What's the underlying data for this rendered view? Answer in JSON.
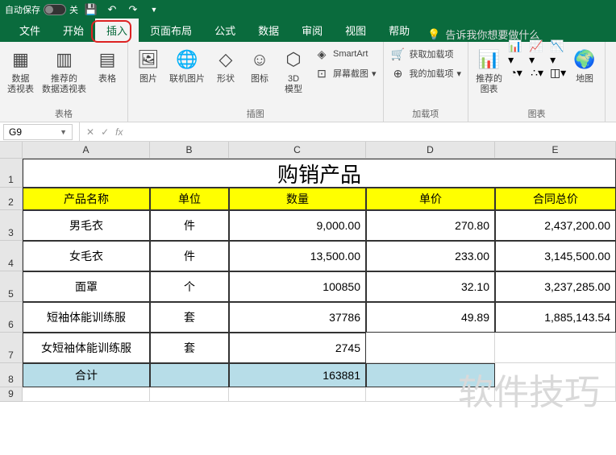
{
  "titlebar": {
    "autosave_label": "自动保存",
    "autosave_state": "关"
  },
  "tabs": {
    "file": "文件",
    "home": "开始",
    "insert": "插入",
    "layout": "页面布局",
    "formulas": "公式",
    "data": "数据",
    "review": "审阅",
    "view": "视图",
    "help": "帮助",
    "tellme": "告诉我你想要做什么"
  },
  "ribbon": {
    "pivot": "数据\n透视表",
    "recpivot": "推荐的\n数据透视表",
    "table": "表格",
    "tables_group": "表格",
    "pictures": "图片",
    "online": "联机图片",
    "shapes": "形状",
    "icons": "图标",
    "model3d": "3D\n模型",
    "smartart": "SmartArt",
    "screenshot": "屏幕截图",
    "illust_group": "插图",
    "getaddins": "获取加载项",
    "myaddins": "我的加载项",
    "addins_group": "加载项",
    "recchart": "推荐的\n图表",
    "charts_group": "图表",
    "map": "地图"
  },
  "namebox": "G9",
  "fx": "fx",
  "cols": {
    "A": "A",
    "B": "B",
    "C": "C",
    "D": "D",
    "E": "E"
  },
  "title": "购销产品",
  "headers": {
    "name": "产品名称",
    "unit": "单位",
    "qty": "数量",
    "price": "单价",
    "total": "合同总价"
  },
  "rows": [
    {
      "n": "男毛衣",
      "u": "件",
      "q": "9,000.00",
      "p": "270.80",
      "t": "2,437,200.00"
    },
    {
      "n": "女毛衣",
      "u": "件",
      "q": "13,500.00",
      "p": "233.00",
      "t": "3,145,500.00"
    },
    {
      "n": "面罩",
      "u": "个",
      "q": "100850",
      "p": "32.10",
      "t": "3,237,285.00"
    },
    {
      "n": "短袖体能训练服",
      "u": "套",
      "q": "37786",
      "p": "49.89",
      "t": "1,885,143.54"
    },
    {
      "n": "女短袖体能训练服",
      "u": "套",
      "q": "2745",
      "p": "",
      "t": ""
    }
  ],
  "sum": {
    "label": "合计",
    "qty": "163881"
  },
  "watermark": "软件技巧",
  "chart_data": {
    "type": "table",
    "title": "购销产品",
    "columns": [
      "产品名称",
      "单位",
      "数量",
      "单价",
      "合同总价"
    ],
    "rows": [
      [
        "男毛衣",
        "件",
        9000.0,
        270.8,
        2437200.0
      ],
      [
        "女毛衣",
        "件",
        13500.0,
        233.0,
        3145500.0
      ],
      [
        "面罩",
        "个",
        100850,
        32.1,
        3237285.0
      ],
      [
        "短袖体能训练服",
        "套",
        37786,
        49.89,
        1885143.54
      ],
      [
        "女短袖体能训练服",
        "套",
        2745,
        null,
        null
      ]
    ],
    "totals": {
      "数量": 163881
    }
  }
}
